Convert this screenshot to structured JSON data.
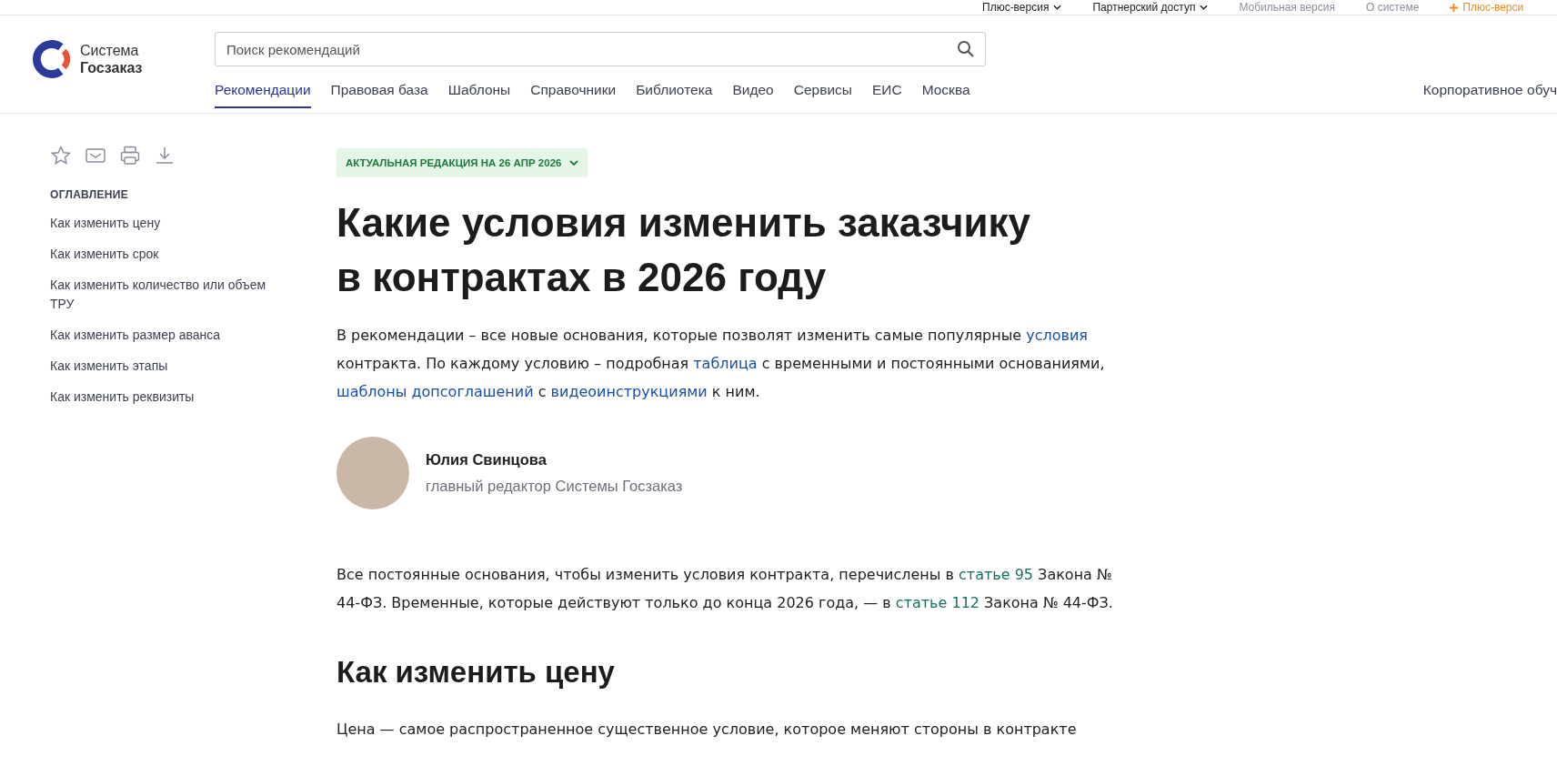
{
  "top_links": [
    {
      "label": "Плюс-версия",
      "kind": "dropdown"
    },
    {
      "label": "Партнерский доступ",
      "kind": "dropdown"
    },
    {
      "label": "Мобильная версия",
      "kind": "plain"
    },
    {
      "label": "О системе",
      "kind": "plain"
    },
    {
      "label": "Плюс-верси",
      "kind": "promo"
    }
  ],
  "logo": {
    "line1": "Система",
    "line2": "Госзаказ"
  },
  "search": {
    "placeholder": "Поиск рекомендаций"
  },
  "nav": [
    {
      "label": "Рекомендации",
      "selected": true
    },
    {
      "label": "Правовая база",
      "selected": false
    },
    {
      "label": "Шаблоны",
      "selected": false
    },
    {
      "label": "Справочники",
      "selected": false
    },
    {
      "label": "Библиотека",
      "selected": false
    },
    {
      "label": "Видео",
      "selected": false
    },
    {
      "label": "Сервисы",
      "selected": false
    },
    {
      "label": "ЕИС",
      "selected": false
    },
    {
      "label": "Москва",
      "selected": false
    }
  ],
  "nav_right": "Корпоративное обуч",
  "toc": {
    "title": "ОГЛАВЛЕНИЕ",
    "items": [
      "Как изменить цену",
      "Как изменить срок",
      "Как изменить количество или объем ТРУ",
      "Как изменить размер аванса",
      "Как изменить этапы",
      "Как изменить реквизиты"
    ]
  },
  "edition_badge": "АКТУАЛЬНАЯ РЕДАКЦИЯ НА 26 АПР 2026",
  "title": "Какие условия изменить заказчику в контрактах в 2026 году",
  "intro": [
    {
      "kind": "text",
      "text": "В рекомендации – все новые основания, которые позволят изменить самые популярные "
    },
    {
      "kind": "link",
      "text": "условия"
    },
    {
      "kind": "text",
      "text": " контракта. По каждому условию – подробная "
    },
    {
      "kind": "link",
      "text": "таблица"
    },
    {
      "kind": "text",
      "text": " с временными и постоянными основаниями, "
    },
    {
      "kind": "link",
      "text": "шаблоны допсоглашений"
    },
    {
      "kind": "text",
      "text": " с "
    },
    {
      "kind": "link",
      "text": "видеоинструкциями"
    },
    {
      "kind": "text",
      "text": " к ним."
    }
  ],
  "author": {
    "name": "Юлия Свинцова",
    "role": "главный редактор Системы Госзаказ"
  },
  "law_paragraph": [
    {
      "kind": "text",
      "text": "Все постоянные основания, чтобы изменить условия контракта, перечислены в "
    },
    {
      "kind": "law-link",
      "text": "статье 95"
    },
    {
      "kind": "text",
      "text": " Закона № 44-ФЗ. Временные, которые действуют только до конца 2026 года, — в "
    },
    {
      "kind": "law-link",
      "text": "статье 112"
    },
    {
      "kind": "text",
      "text": " Закона № 44-ФЗ."
    }
  ],
  "section_heading": "Как изменить цену",
  "section_text": "Цена — самое распространенное существенное условие, которое меняют стороны в контракте"
}
